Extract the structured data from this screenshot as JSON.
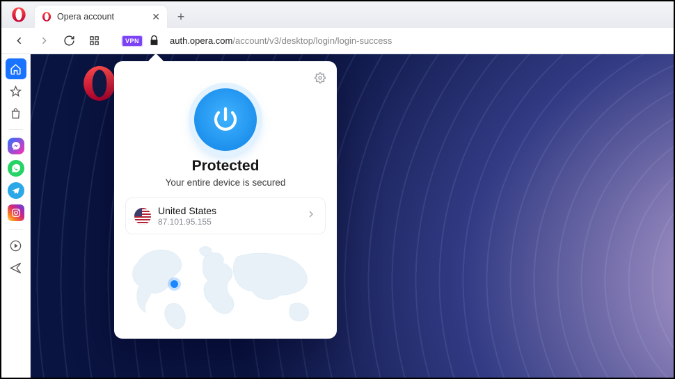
{
  "tab": {
    "title": "Opera account"
  },
  "url": {
    "domain": "auth.opera.com",
    "path": "/account/v3/desktop/login/login-success"
  },
  "vpn": {
    "badge": "VPN",
    "status_title": "Protected",
    "status_subtitle": "Your entire device is secured",
    "location": {
      "name": "United States",
      "ip": "87.101.95.155"
    }
  }
}
